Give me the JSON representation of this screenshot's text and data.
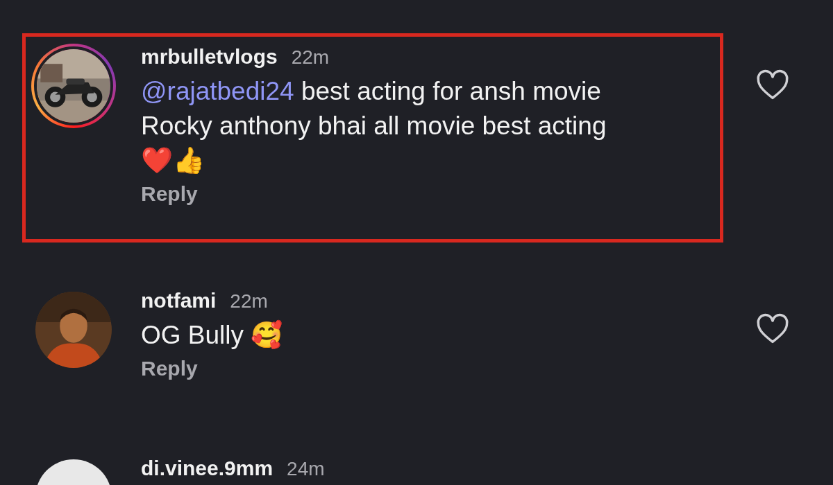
{
  "comments": [
    {
      "username": "mrbulletvlogs",
      "time": "22m",
      "story_ring": true,
      "highlighted": true,
      "mention": "@rajatbedi24",
      "text": " best acting for ansh movie\nRocky anthony bhai all movie best acting\n❤️👍",
      "reply": "Reply",
      "liked": false
    },
    {
      "username": "notfami",
      "time": "22m",
      "story_ring": false,
      "highlighted": false,
      "text": "OG Bully 🥰",
      "reply": "Reply",
      "liked": false
    },
    {
      "username": "di.vinee.9mm",
      "time": "24m",
      "avatar": {
        "kind": "default"
      }
    }
  ]
}
